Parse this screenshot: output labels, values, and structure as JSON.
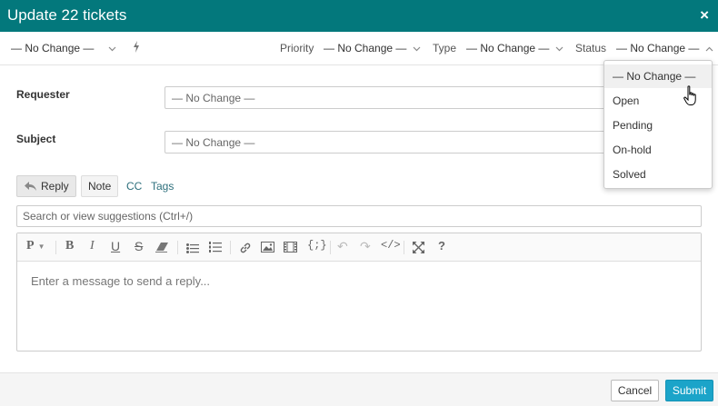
{
  "dialog": {
    "title": "Update 22 tickets",
    "close_label": "×"
  },
  "toolbar": {
    "macro_value": "— No Change —",
    "priority_label": "Priority",
    "priority_value": "— No Change —",
    "type_label": "Type",
    "type_value": "— No Change —",
    "status_label": "Status",
    "status_value": "— No Change —"
  },
  "form": {
    "requester_label": "Requester",
    "requester_value": "— No Change —",
    "subject_label": "Subject",
    "subject_value": "— No Change —"
  },
  "compose": {
    "reply_label": "Reply",
    "note_label": "Note",
    "cc_label": "CC",
    "tags_label": "Tags",
    "search_placeholder": "Search or view suggestions (Ctrl+/)",
    "editor_placeholder": "Enter a message to send a reply...",
    "paragraph_label": "P"
  },
  "status_dropdown": {
    "options": [
      "— No Change —",
      "Open",
      "Pending",
      "On-hold",
      "Solved"
    ],
    "highlighted": "— No Change —"
  },
  "footer": {
    "cancel_label": "Cancel",
    "submit_label": "Submit"
  },
  "colors": {
    "header": "#03787c",
    "submit": "#1ba4c9",
    "link": "#2d6f7c"
  }
}
